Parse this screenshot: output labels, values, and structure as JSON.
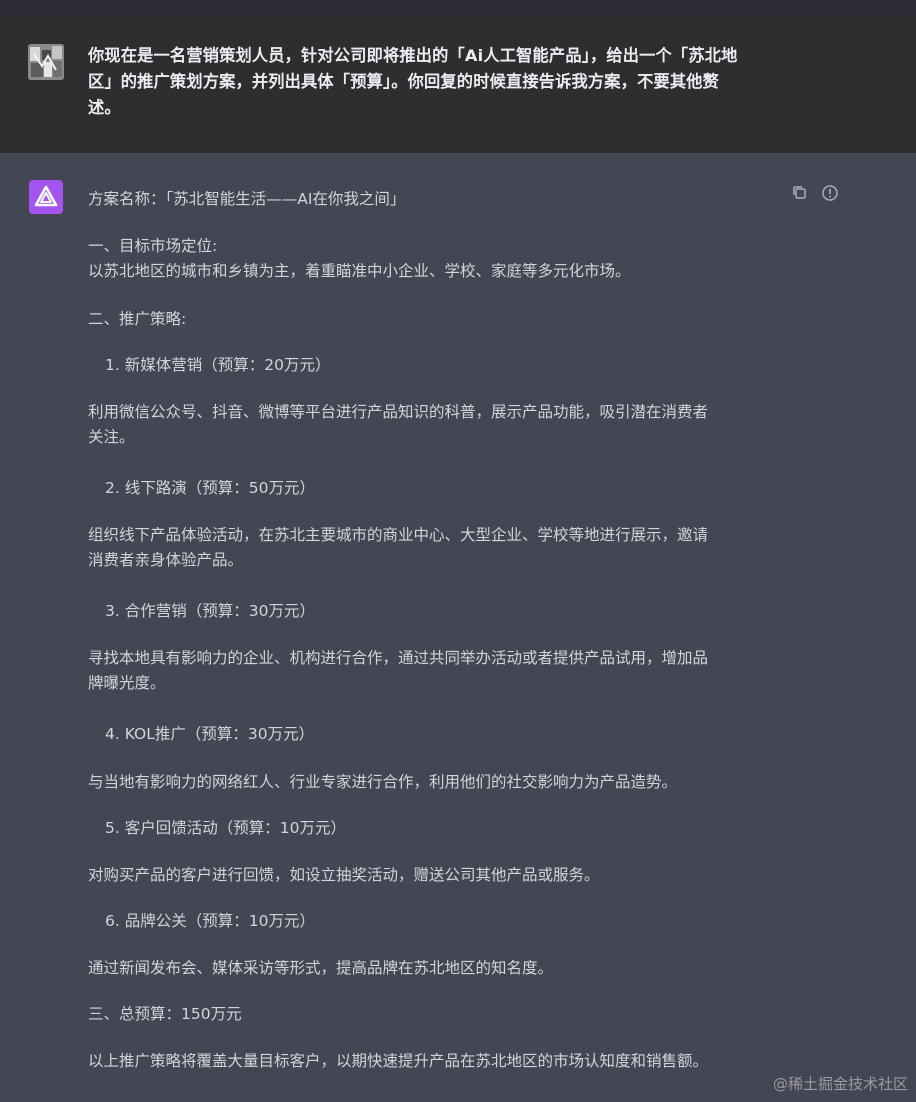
{
  "user_message": {
    "line1": "你现在是一名营销策划人员，针对公司即将推出的「Ai人工智能产品」，给出一个「苏北地",
    "line2": "区」的推广策划方案，并列出具体「预算」。你回复的时候直接告诉我方案，不要其他赘",
    "line3": "述。"
  },
  "assistant_message": {
    "title": "方案名称：「苏北智能生活——AI在你我之间」",
    "section1_heading": "一、目标市场定位:",
    "section1_body": "以苏北地区的城市和乡镇为主，着重瞄准中小企业、学校、家庭等多元化市场。",
    "section2_heading": "二、推广策略:",
    "items": [
      {
        "label": "1. 新媒体营销（预算：20万元）",
        "desc1": "利用微信公众号、抖音、微博等平台进行产品知识的科普，展示产品功能，吸引潜在消费者",
        "desc2": "关注。"
      },
      {
        "label": "2. 线下路演（预算：50万元）",
        "desc1": "组织线下产品体验活动，在苏北主要城市的商业中心、大型企业、学校等地进行展示，邀请",
        "desc2": "消费者亲身体验产品。"
      },
      {
        "label": "3. 合作营销（预算：30万元）",
        "desc1": "寻找本地具有影响力的企业、机构进行合作，通过共同举办活动或者提供产品试用，增加品",
        "desc2": "牌曝光度。"
      },
      {
        "label": "4. KOL推广（预算：30万元）",
        "desc1": "与当地有影响力的网络红人、行业专家进行合作，利用他们的社交影响力为产品造势。"
      },
      {
        "label": "5. 客户回馈活动（预算：10万元）",
        "desc1": "对购买产品的客户进行回馈，如设立抽奖活动，赠送公司其他产品或服务。"
      },
      {
        "label": "6. 品牌公关（预算：10万元）",
        "desc1": "通过新闻发布会、媒体采访等形式，提高品牌在苏北地区的知名度。"
      }
    ],
    "section3_heading": "三、总预算：150万元",
    "conclusion": "以上推广策略将覆盖大量目标客户，以期快速提升产品在苏北地区的市场认知度和销售额。"
  },
  "icons": {
    "copy": "copy-icon",
    "report": "report-icon",
    "assistant_logo": "assistant-logo-icon",
    "user_avatar": "user-avatar"
  },
  "watermark": "@稀土掘金技术社区",
  "colors": {
    "background": "#343541",
    "user_block": "#2e2e31",
    "assistant_block": "#444654",
    "assistant_avatar": "#a455ef",
    "text": "#d1d5db"
  }
}
